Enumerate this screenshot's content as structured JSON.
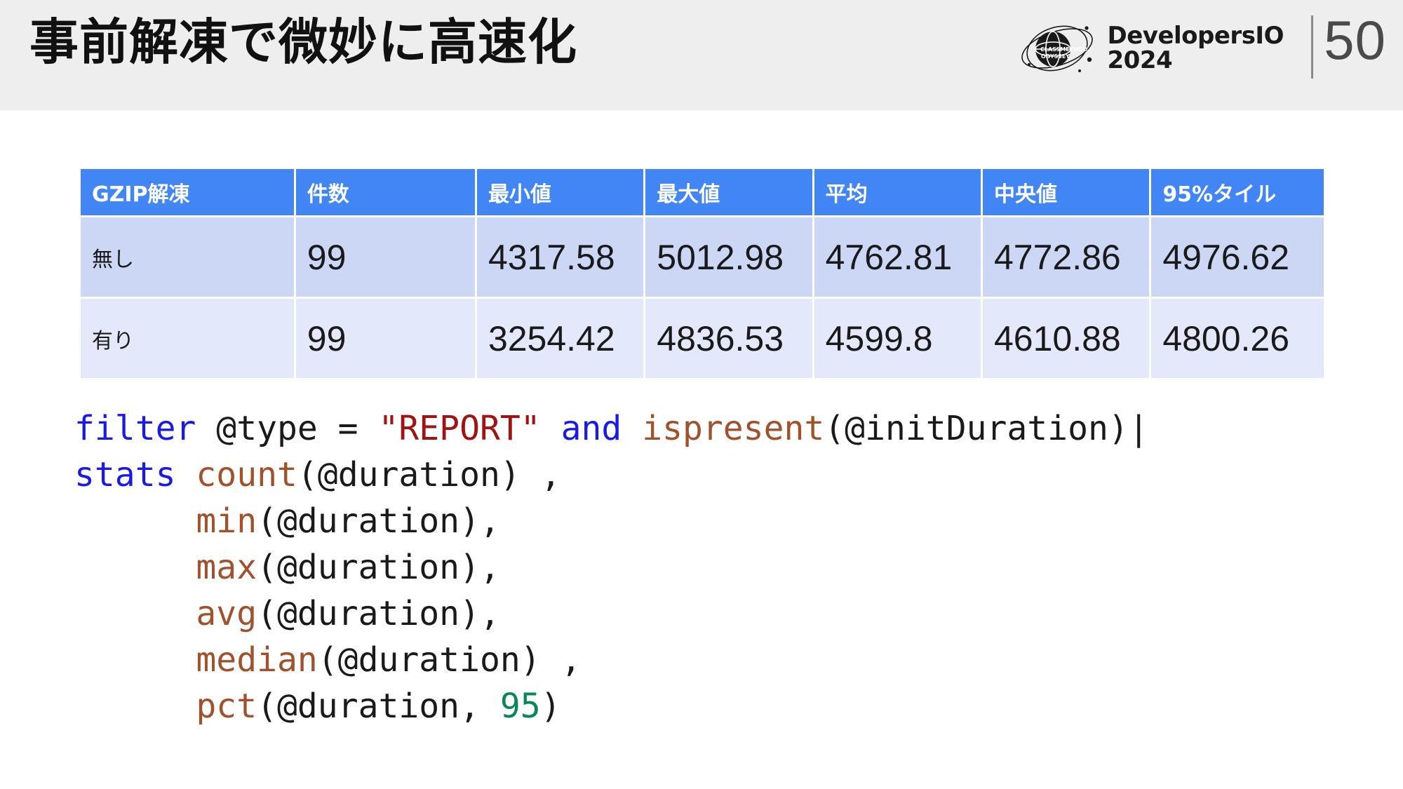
{
  "header": {
    "title": "事前解凍で微妙に高速化",
    "brand_name": "DevelopersIO",
    "brand_year": "2024",
    "logo_icon": "globe-orbit-icon",
    "page_number": "50",
    "band_color": "#eeeeee"
  },
  "table": {
    "accent_header_color": "#4285f4",
    "row_odd_color": "#ccd6f5",
    "row_even_color": "#e4e8fb",
    "columns": [
      "GZIP解凍",
      "件数",
      "最小値",
      "最大値",
      "平均",
      "中央値",
      "95%タイル"
    ],
    "rows": [
      {
        "label": "無し",
        "count": "99",
        "min": "4317.58",
        "max": "5012.98",
        "avg": "4762.81",
        "median": "4772.86",
        "p95": "4976.62"
      },
      {
        "label": "有り",
        "count": "99",
        "min": "3254.42",
        "max": "4836.53",
        "avg": "4599.8",
        "median": "4610.88",
        "p95": "4800.26"
      }
    ]
  },
  "code": {
    "language": "cloudwatch-logs-insights",
    "colors": {
      "keyword": "#1a1ae6",
      "function": "#a0522d",
      "string": "#a11212",
      "number": "#0a8754",
      "plain": "#1a1a1a"
    },
    "lines": [
      {
        "tokens": [
          {
            "t": "filter",
            "k": "kw"
          },
          {
            "t": " @type = ",
            "k": "pln"
          },
          {
            "t": "\"REPORT\"",
            "k": "str"
          },
          {
            "t": " ",
            "k": "pln"
          },
          {
            "t": "and",
            "k": "kw"
          },
          {
            "t": " ",
            "k": "pln"
          },
          {
            "t": "ispresent",
            "k": "fn"
          },
          {
            "t": "(@initDuration)|",
            "k": "pln"
          }
        ]
      },
      {
        "tokens": [
          {
            "t": "stats",
            "k": "kw"
          },
          {
            "t": " ",
            "k": "pln"
          },
          {
            "t": "count",
            "k": "fn"
          },
          {
            "t": "(@duration) ,",
            "k": "pln"
          }
        ]
      },
      {
        "tokens": [
          {
            "t": "      ",
            "k": "pln"
          },
          {
            "t": "min",
            "k": "fn"
          },
          {
            "t": "(@duration),",
            "k": "pln"
          }
        ]
      },
      {
        "tokens": [
          {
            "t": "      ",
            "k": "pln"
          },
          {
            "t": "max",
            "k": "fn"
          },
          {
            "t": "(@duration),",
            "k": "pln"
          }
        ]
      },
      {
        "tokens": [
          {
            "t": "      ",
            "k": "pln"
          },
          {
            "t": "avg",
            "k": "fn"
          },
          {
            "t": "(@duration),",
            "k": "pln"
          }
        ]
      },
      {
        "tokens": [
          {
            "t": "      ",
            "k": "pln"
          },
          {
            "t": "median",
            "k": "fn"
          },
          {
            "t": "(@duration) ,",
            "k": "pln"
          }
        ]
      },
      {
        "tokens": [
          {
            "t": "      ",
            "k": "pln"
          },
          {
            "t": "pct",
            "k": "fn"
          },
          {
            "t": "(@duration, ",
            "k": "pln"
          },
          {
            "t": "95",
            "k": "num"
          },
          {
            "t": ")",
            "k": "pln"
          }
        ]
      }
    ]
  }
}
